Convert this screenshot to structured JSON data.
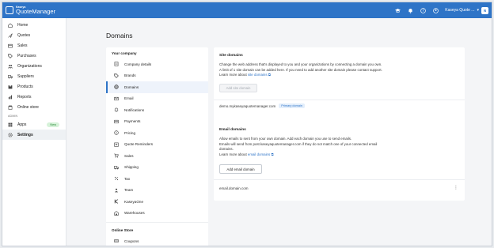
{
  "app": {
    "brand_small": "Kaseya",
    "brand_name": "QuoteManager",
    "user_name": "Kaseya Quote ...",
    "avatar_initial": "N"
  },
  "leftnav": {
    "items": [
      {
        "label": "Home",
        "icon": "home-icon"
      },
      {
        "label": "Quotes",
        "icon": "send-icon"
      },
      {
        "label": "Sales",
        "icon": "sales-icon"
      },
      {
        "label": "Purchases",
        "icon": "tag-icon"
      },
      {
        "label": "Organizations",
        "icon": "organizations-icon"
      },
      {
        "label": "Suppliers",
        "icon": "truck-icon"
      },
      {
        "label": "Products",
        "icon": "box-icon"
      },
      {
        "label": "Reports",
        "icon": "chart-icon"
      },
      {
        "label": "Online store",
        "icon": "store-icon"
      }
    ],
    "admin_section": "ADMIN",
    "apps_label": "Apps",
    "apps_badge": "New",
    "settings_label": "Settings"
  },
  "page": {
    "title": "Domains"
  },
  "settings_nav": {
    "section1": "Your company",
    "items": [
      {
        "label": "Company details",
        "icon": "building-icon"
      },
      {
        "label": "Brands",
        "icon": "tag-icon"
      },
      {
        "label": "Domains",
        "icon": "globe-icon"
      },
      {
        "label": "Email",
        "icon": "mail-icon"
      },
      {
        "label": "Notifications",
        "icon": "bell-icon"
      },
      {
        "label": "Payments",
        "icon": "credit-card-icon"
      },
      {
        "label": "Pricing",
        "icon": "pricing-icon"
      },
      {
        "label": "Quote Reminders",
        "icon": "reminder-icon"
      },
      {
        "label": "Sales",
        "icon": "cart-icon"
      },
      {
        "label": "Shipping",
        "icon": "truck-icon"
      },
      {
        "label": "Tax",
        "icon": "percent-icon"
      },
      {
        "label": "Team",
        "icon": "team-icon"
      },
      {
        "label": "KaseyaOne",
        "icon": "kaseya-icon"
      },
      {
        "label": "Warehouses",
        "icon": "warehouse-icon"
      }
    ],
    "section2": "Online Store",
    "items2": [
      {
        "label": "Coupons",
        "icon": "coupon-icon"
      }
    ]
  },
  "site_domains": {
    "title": "Site domains",
    "line1": "Change the web address that's displayed to you and your organizations by connecting a domain you own.",
    "line2": "A limit of 1 site domain can be added here. If you need to add another site domain please contact support.",
    "learn_prefix": "Learn more about ",
    "learn_link": "site domains",
    "add_button": "Add site domain",
    "domain": "demo.mykaseyaquotemanager.com",
    "primary_badge": "Primary domain"
  },
  "email_domains": {
    "title": "Email domains",
    "line1": "Allow emails to sent from your own domain. Add each domain you use to send emails.",
    "line2": "Emails will send from post.kaseyaquotemanager.com if they do not match one of your connected email",
    "line3": "domains.",
    "learn_prefix": "Learn more about ",
    "learn_link": "email domains",
    "add_button": "Add email domain",
    "domain": "email.domain.com",
    "more_glyph": "⋮"
  }
}
